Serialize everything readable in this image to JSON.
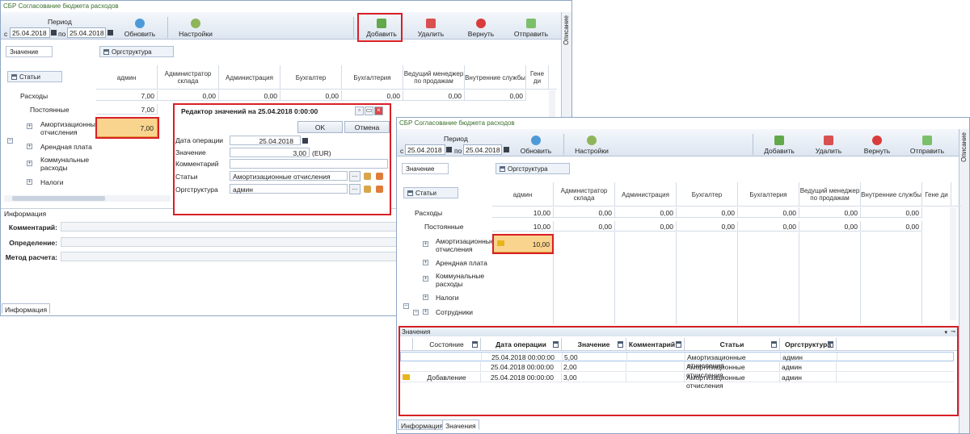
{
  "app_title": "СБР Согласование бюджета расходов",
  "toolbar": {
    "period_label": "Период",
    "from_prefix": "с",
    "to_prefix": "по",
    "date_from": "25.04.2018",
    "date_to": "25.04.2018",
    "refresh": "Обновить",
    "settings": "Настройки",
    "add": "Добавить",
    "delete": "Удалить",
    "return": "Вернуть",
    "send": "Отправить"
  },
  "side_panel": "Описание",
  "filters": {
    "value": "Значение",
    "org": "Оргструктура",
    "articles": "Статьи"
  },
  "columns": [
    "админ",
    "Администратор склада",
    "Администрация",
    "Бухгалтер",
    "Бухгалтерия",
    "Ведущий менеджер по продажам",
    "Внутренние службы",
    "Гене ди"
  ],
  "rows_back": {
    "expenses": "Расходы",
    "fixed": "Постоянные",
    "amort": "Амортизационные отчисления",
    "rent": "Арендная плата",
    "utilities": "Коммунальные расходы",
    "taxes": "Налоги",
    "expenses_vals": [
      "7,00",
      "0,00",
      "0,00",
      "0,00",
      "0,00",
      "0,00",
      "0,00"
    ],
    "fixed_vals": [
      "7,00"
    ],
    "amort_val": "7,00"
  },
  "rows_front": {
    "expenses": "Расходы",
    "fixed": "Постоянные",
    "amort": "Амортизационные отчисления",
    "rent": "Арендная плата",
    "utilities": "Коммунальные расходы",
    "taxes": "Налоги",
    "staff": "Сотрудники",
    "expenses_vals": [
      "10,00",
      "0,00",
      "0,00",
      "0,00",
      "0,00",
      "0,00",
      "0,00"
    ],
    "fixed_vals": [
      "10,00",
      "0,00",
      "0,00",
      "0,00",
      "0,00",
      "0,00",
      "0,00"
    ],
    "amort_val": "10,00"
  },
  "dialog": {
    "title": "Редактор значений на 25.04.2018 0:00:00",
    "ok": "OK",
    "cancel": "Отмена",
    "op_date_label": "Дата операции",
    "op_date": "25.04.2018",
    "value_label": "Значение",
    "value": "3,00",
    "currency": "(EUR)",
    "comment_label": "Комментарий",
    "articles_label": "Статьи",
    "articles": "Амортизационные отчисления",
    "org_label": "Оргструктура",
    "org": "админ",
    "ellipsis": "..."
  },
  "info": {
    "title": "Информация",
    "comment": "Комментарий:",
    "definition": "Определение:",
    "method": "Метод расчета:",
    "tab": "Информация"
  },
  "values_panel": {
    "title": "Значения",
    "headers": [
      "Состояние",
      "Дата операции",
      "Значение",
      "Комментарий",
      "Статьи",
      "Оргструктура"
    ],
    "rows": [
      {
        "state": "",
        "date": "25.04.2018 00:00:00",
        "value": "5,00",
        "comment": "",
        "article": "Амортизационные отчисления",
        "org": "админ"
      },
      {
        "state": "",
        "date": "25.04.2018 00:00:00",
        "value": "2,00",
        "comment": "",
        "article": "Амортизационные отчисления",
        "org": "админ"
      },
      {
        "state": "Добавление",
        "date": "25.04.2018 00:00:00",
        "value": "3,00",
        "comment": "",
        "article": "Амортизационные отчисления",
        "org": "админ"
      }
    ],
    "tabs": [
      "Информация",
      "Значения"
    ]
  },
  "colors": {
    "highlight": "#d81f26",
    "cell_fill": "#f9d48e",
    "title_green": "#3a6f2a"
  }
}
